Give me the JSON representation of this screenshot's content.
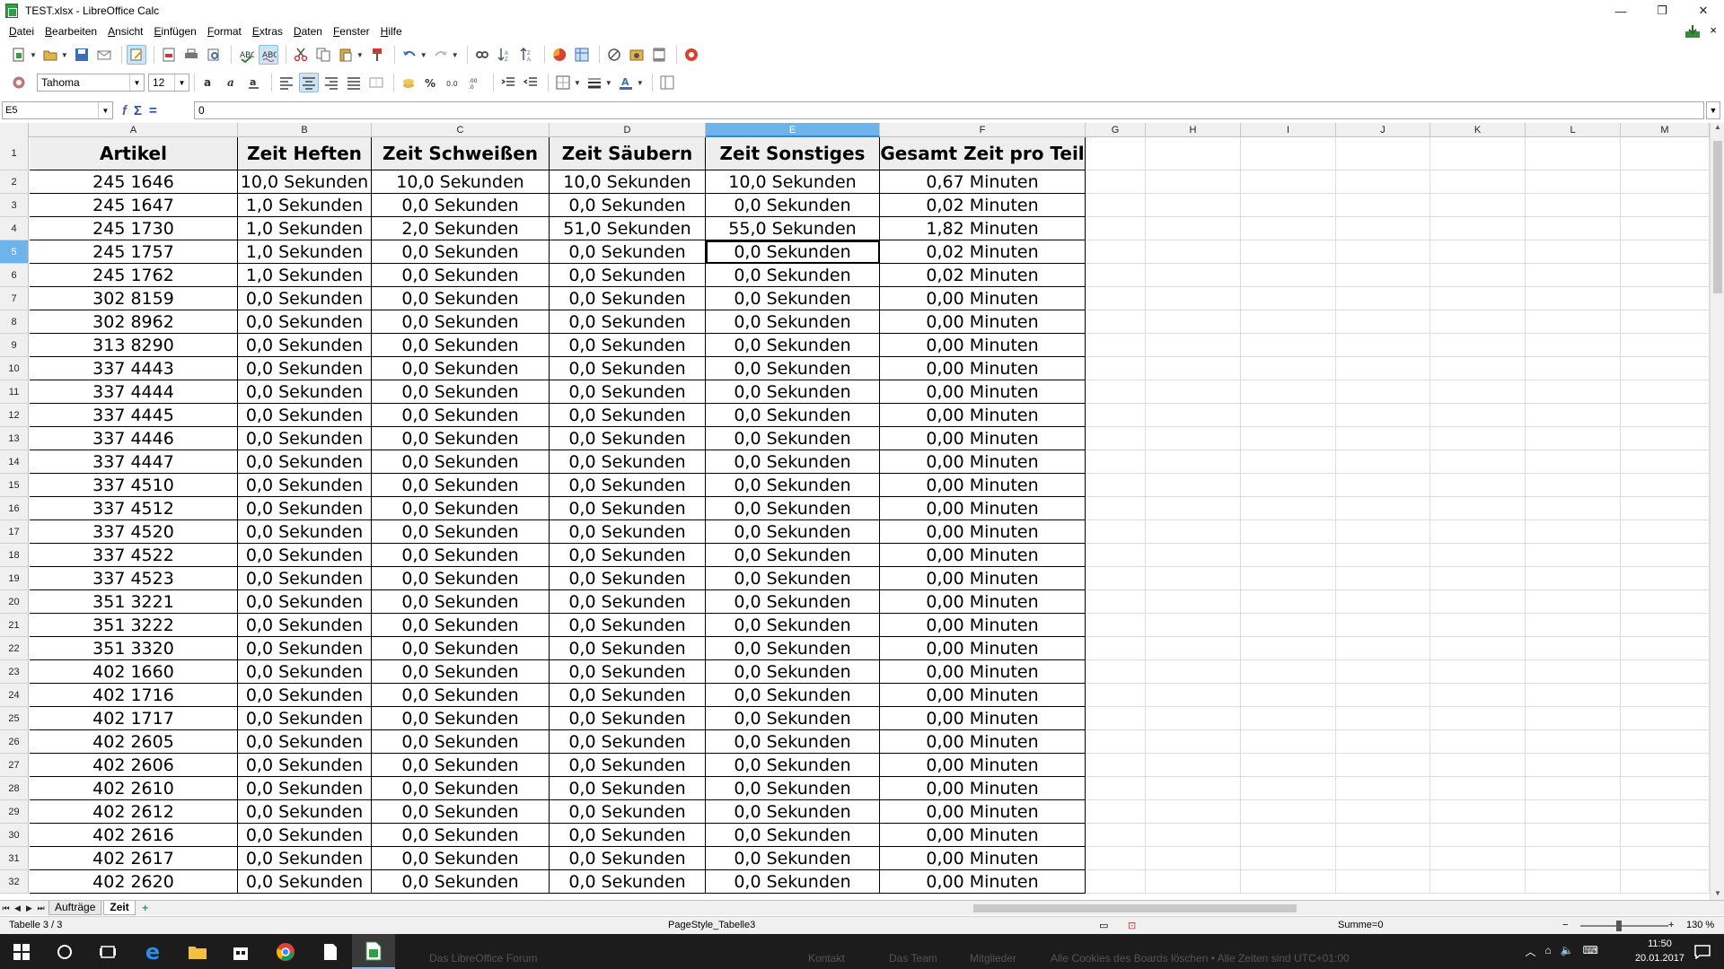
{
  "window": {
    "title": "TEST.xlsx - LibreOffice Calc",
    "minimize": "—",
    "restore": "❐",
    "close": "✕"
  },
  "menu": [
    {
      "ul": "D",
      "rest": "atei"
    },
    {
      "ul": "B",
      "rest": "earbeiten"
    },
    {
      "ul": "A",
      "rest": "nsicht"
    },
    {
      "ul": "E",
      "rest": "infügen"
    },
    {
      "ul": "F",
      "rest": "ormat"
    },
    {
      "ul": "E",
      "rest": "xtras"
    },
    {
      "ul": "D",
      "rest": "aten"
    },
    {
      "ul": "F",
      "rest": "enster"
    },
    {
      "ul": "H",
      "rest": "ilfe"
    }
  ],
  "doc_close": "×",
  "formatting": {
    "font": "Tahoma",
    "size": "12"
  },
  "formula": {
    "cell_ref": "E5",
    "value": "0"
  },
  "columns": [
    "A",
    "B",
    "C",
    "D",
    "E",
    "F",
    "G",
    "H",
    "I",
    "J",
    "K",
    "L",
    "M"
  ],
  "selected_column": "E",
  "selected_row": 5,
  "table": {
    "headers": [
      "Artikel",
      "Zeit Heften",
      "Zeit Schweißen",
      "Zeit Säubern",
      "Zeit Sonstiges",
      "Gesamt Zeit pro Teil"
    ],
    "rows": [
      [
        "245 1646",
        "10,0 Sekunden",
        "10,0 Sekunden",
        "10,0 Sekunden",
        "10,0 Sekunden",
        "0,67 Minuten"
      ],
      [
        "245 1647",
        "1,0 Sekunden",
        "0,0 Sekunden",
        "0,0 Sekunden",
        "0,0 Sekunden",
        "0,02 Minuten"
      ],
      [
        "245 1730",
        "1,0 Sekunden",
        "2,0 Sekunden",
        "51,0 Sekunden",
        "55,0 Sekunden",
        "1,82 Minuten"
      ],
      [
        "245 1757",
        "1,0 Sekunden",
        "0,0 Sekunden",
        "0,0 Sekunden",
        "0,0 Sekunden",
        "0,02 Minuten"
      ],
      [
        "245 1762",
        "1,0 Sekunden",
        "0,0 Sekunden",
        "0,0 Sekunden",
        "0,0 Sekunden",
        "0,02 Minuten"
      ],
      [
        "302 8159",
        "0,0 Sekunden",
        "0,0 Sekunden",
        "0,0 Sekunden",
        "0,0 Sekunden",
        "0,00 Minuten"
      ],
      [
        "302 8962",
        "0,0 Sekunden",
        "0,0 Sekunden",
        "0,0 Sekunden",
        "0,0 Sekunden",
        "0,00 Minuten"
      ],
      [
        "313 8290",
        "0,0 Sekunden",
        "0,0 Sekunden",
        "0,0 Sekunden",
        "0,0 Sekunden",
        "0,00 Minuten"
      ],
      [
        "337 4443",
        "0,0 Sekunden",
        "0,0 Sekunden",
        "0,0 Sekunden",
        "0,0 Sekunden",
        "0,00 Minuten"
      ],
      [
        "337 4444",
        "0,0 Sekunden",
        "0,0 Sekunden",
        "0,0 Sekunden",
        "0,0 Sekunden",
        "0,00 Minuten"
      ],
      [
        "337 4445",
        "0,0 Sekunden",
        "0,0 Sekunden",
        "0,0 Sekunden",
        "0,0 Sekunden",
        "0,00 Minuten"
      ],
      [
        "337 4446",
        "0,0 Sekunden",
        "0,0 Sekunden",
        "0,0 Sekunden",
        "0,0 Sekunden",
        "0,00 Minuten"
      ],
      [
        "337 4447",
        "0,0 Sekunden",
        "0,0 Sekunden",
        "0,0 Sekunden",
        "0,0 Sekunden",
        "0,00 Minuten"
      ],
      [
        "337 4510",
        "0,0 Sekunden",
        "0,0 Sekunden",
        "0,0 Sekunden",
        "0,0 Sekunden",
        "0,00 Minuten"
      ],
      [
        "337 4512",
        "0,0 Sekunden",
        "0,0 Sekunden",
        "0,0 Sekunden",
        "0,0 Sekunden",
        "0,00 Minuten"
      ],
      [
        "337 4520",
        "0,0 Sekunden",
        "0,0 Sekunden",
        "0,0 Sekunden",
        "0,0 Sekunden",
        "0,00 Minuten"
      ],
      [
        "337 4522",
        "0,0 Sekunden",
        "0,0 Sekunden",
        "0,0 Sekunden",
        "0,0 Sekunden",
        "0,00 Minuten"
      ],
      [
        "337 4523",
        "0,0 Sekunden",
        "0,0 Sekunden",
        "0,0 Sekunden",
        "0,0 Sekunden",
        "0,00 Minuten"
      ],
      [
        "351 3221",
        "0,0 Sekunden",
        "0,0 Sekunden",
        "0,0 Sekunden",
        "0,0 Sekunden",
        "0,00 Minuten"
      ],
      [
        "351 3222",
        "0,0 Sekunden",
        "0,0 Sekunden",
        "0,0 Sekunden",
        "0,0 Sekunden",
        "0,00 Minuten"
      ],
      [
        "351 3320",
        "0,0 Sekunden",
        "0,0 Sekunden",
        "0,0 Sekunden",
        "0,0 Sekunden",
        "0,00 Minuten"
      ],
      [
        "402 1660",
        "0,0 Sekunden",
        "0,0 Sekunden",
        "0,0 Sekunden",
        "0,0 Sekunden",
        "0,00 Minuten"
      ],
      [
        "402 1716",
        "0,0 Sekunden",
        "0,0 Sekunden",
        "0,0 Sekunden",
        "0,0 Sekunden",
        "0,00 Minuten"
      ],
      [
        "402 1717",
        "0,0 Sekunden",
        "0,0 Sekunden",
        "0,0 Sekunden",
        "0,0 Sekunden",
        "0,00 Minuten"
      ],
      [
        "402 2605",
        "0,0 Sekunden",
        "0,0 Sekunden",
        "0,0 Sekunden",
        "0,0 Sekunden",
        "0,00 Minuten"
      ],
      [
        "402 2606",
        "0,0 Sekunden",
        "0,0 Sekunden",
        "0,0 Sekunden",
        "0,0 Sekunden",
        "0,00 Minuten"
      ],
      [
        "402 2610",
        "0,0 Sekunden",
        "0,0 Sekunden",
        "0,0 Sekunden",
        "0,0 Sekunden",
        "0,00 Minuten"
      ],
      [
        "402 2612",
        "0,0 Sekunden",
        "0,0 Sekunden",
        "0,0 Sekunden",
        "0,0 Sekunden",
        "0,00 Minuten"
      ],
      [
        "402 2616",
        "0,0 Sekunden",
        "0,0 Sekunden",
        "0,0 Sekunden",
        "0,0 Sekunden",
        "0,00 Minuten"
      ],
      [
        "402 2617",
        "0,0 Sekunden",
        "0,0 Sekunden",
        "0,0 Sekunden",
        "0,0 Sekunden",
        "0,00 Minuten"
      ],
      [
        "402 2620",
        "0,0 Sekunden",
        "0,0 Sekunden",
        "0,0 Sekunden",
        "0,0 Sekunden",
        "0,00 Minuten"
      ]
    ]
  },
  "sheets": [
    {
      "name": "Aufträge",
      "active": false
    },
    {
      "name": "Zeit",
      "active": true
    }
  ],
  "status": {
    "sheet_info": "Tabelle 3 / 3",
    "page_style": "PageStyle_Tabelle3",
    "sum": "Summe=0",
    "zoom_minus": "−",
    "zoom_plus": "+",
    "zoom": "130 %"
  },
  "taskbar": {
    "time": "11:50",
    "date": "20.01.2017",
    "behind_text": [
      "Das LibreOffice Forum",
      "Kontakt",
      "Das Team",
      "Mitglieder",
      "Alle Cookies des Boards löschen • Alle Zeiten sind UTC+01:00"
    ]
  },
  "colors": {
    "selection": "#6eb3ea",
    "header_fill": "#eeeeee",
    "taskbar": "#1c1c1c"
  }
}
